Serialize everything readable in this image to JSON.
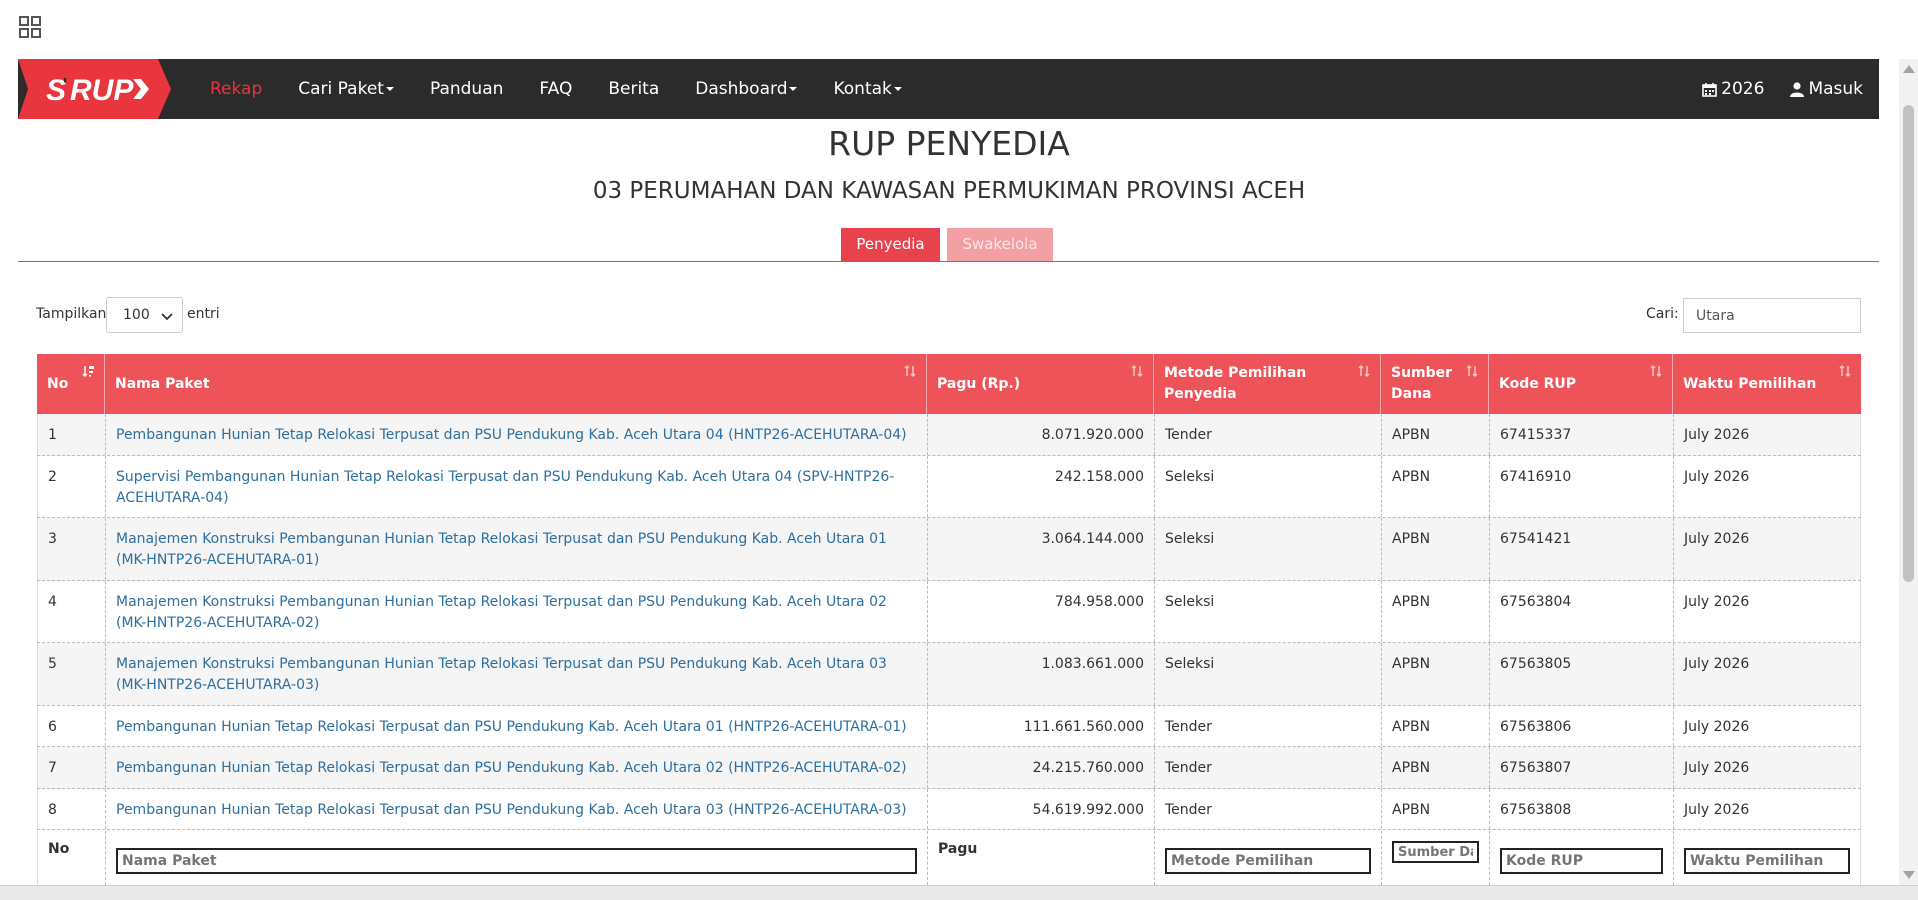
{
  "topbar": {
    "app_grid_icon": "apps-grid-icon"
  },
  "navbar": {
    "logo_text": "SiRUP",
    "items": [
      {
        "label": "Rekap",
        "active": true,
        "dropdown": false
      },
      {
        "label": "Cari Paket",
        "active": false,
        "dropdown": true
      },
      {
        "label": "Panduan",
        "active": false,
        "dropdown": false
      },
      {
        "label": "FAQ",
        "active": false,
        "dropdown": false
      },
      {
        "label": "Berita",
        "active": false,
        "dropdown": false
      },
      {
        "label": "Dashboard",
        "active": false,
        "dropdown": true
      },
      {
        "label": "Kontak",
        "active": false,
        "dropdown": true
      }
    ],
    "year": "2026",
    "login": "Masuk"
  },
  "page": {
    "title": "RUP PENYEDIA",
    "subtitle": "03 PERUMAHAN DAN KAWASAN PERMUKIMAN PROVINSI ACEH"
  },
  "tabs": [
    "Penyedia",
    "Swakelola"
  ],
  "controls": {
    "length_label": "Tampilkan",
    "length_value": "100",
    "length_after": "entri",
    "search_label": "Cari:",
    "search_value": "Utara"
  },
  "table": {
    "headers": [
      "No",
      "Nama Paket",
      "Pagu (Rp.)",
      "Metode Pemilihan Penyedia",
      "Sumber Dana",
      "Kode RUP",
      "Waktu Pemilihan"
    ],
    "rows": [
      [
        "1",
        "Pembangunan Hunian Tetap Relokasi Terpusat dan PSU Pendukung Kab. Aceh Utara 04 (HNTP26-ACEHUTARA-04)",
        "8.071.920.000",
        "Tender",
        "APBN",
        "67415337",
        "July 2026"
      ],
      [
        "2",
        "Supervisi Pembangunan Hunian Tetap Relokasi Terpusat dan PSU Pendukung Kab. Aceh Utara 04 (SPV-HNTP26-ACEHUTARA-04)",
        "242.158.000",
        "Seleksi",
        "APBN",
        "67416910",
        "July 2026"
      ],
      [
        "3",
        "Manajemen Konstruksi Pembangunan Hunian Tetap Relokasi Terpusat dan PSU Pendukung Kab. Aceh Utara 01 (MK-HNTP26-ACEHUTARA-01)",
        "3.064.144.000",
        "Seleksi",
        "APBN",
        "67541421",
        "July 2026"
      ],
      [
        "4",
        "Manajemen Konstruksi Pembangunan Hunian Tetap Relokasi Terpusat dan PSU Pendukung Kab. Aceh Utara 02 (MK-HNTP26-ACEHUTARA-02)",
        "784.958.000",
        "Seleksi",
        "APBN",
        "67563804",
        "July 2026"
      ],
      [
        "5",
        "Manajemen Konstruksi Pembangunan Hunian Tetap Relokasi Terpusat dan PSU Pendukung Kab. Aceh Utara 03 (MK-HNTP26-ACEHUTARA-03)",
        "1.083.661.000",
        "Seleksi",
        "APBN",
        "67563805",
        "July 2026"
      ],
      [
        "6",
        "Pembangunan Hunian Tetap Relokasi Terpusat dan PSU Pendukung Kab. Aceh Utara 01 (HNTP26-ACEHUTARA-01)",
        "111.661.560.000",
        "Tender",
        "APBN",
        "67563806",
        "July 2026"
      ],
      [
        "7",
        "Pembangunan Hunian Tetap Relokasi Terpusat dan PSU Pendukung Kab. Aceh Utara 02 (HNTP26-ACEHUTARA-02)",
        "24.215.760.000",
        "Tender",
        "APBN",
        "67563807",
        "July 2026"
      ],
      [
        "8",
        "Pembangunan Hunian Tetap Relokasi Terpusat dan PSU Pendukung Kab. Aceh Utara 03 (HNTP26-ACEHUTARA-03)",
        "54.619.992.000",
        "Tender",
        "APBN",
        "67563808",
        "July 2026"
      ]
    ],
    "footer": {
      "no": "No",
      "nama_placeholder": "Nama Paket",
      "pagu": "Pagu",
      "metode_placeholder": "Metode Pemilihan",
      "sumber_placeholder": "Sumber Dana",
      "kode_placeholder": "Kode RUP",
      "waktu_placeholder": "Waktu Pemilihan"
    }
  },
  "colors": {
    "brand_red": "#e8353e",
    "header_red": "#ee535a",
    "nav_dark": "#2b2b2b",
    "link_blue": "#2d6f9e"
  }
}
